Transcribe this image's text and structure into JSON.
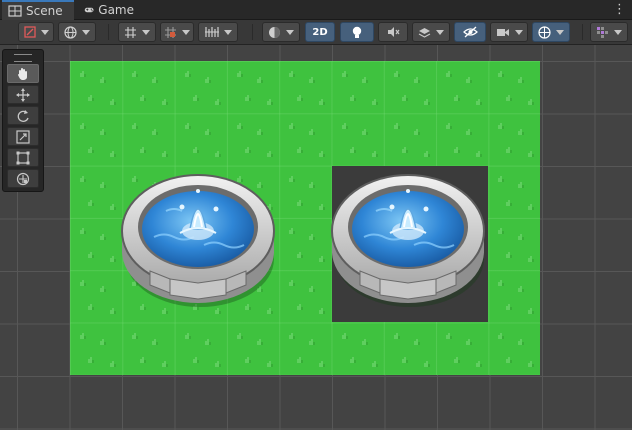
{
  "tabs": [
    {
      "label": "Scene",
      "icon": "scene-grid-icon",
      "active": true
    },
    {
      "label": "Game",
      "icon": "gamepad-icon",
      "active": false
    }
  ],
  "menu_icon": "kebab-menu-icon",
  "toolbar": {
    "mode_2d_label": "2D",
    "mode_2d_active": true,
    "lighting_active": true,
    "gizmo_visibility_active": true,
    "accent_color": "#46607c"
  },
  "tools": [
    {
      "name": "hand-tool",
      "active": true
    },
    {
      "name": "move-tool",
      "active": false
    },
    {
      "name": "rotate-tool",
      "active": false
    },
    {
      "name": "scale-tool",
      "active": false
    },
    {
      "name": "rect-tool",
      "active": false
    },
    {
      "name": "transform-tool",
      "active": false
    }
  ],
  "scene": {
    "grass_color": "#3fc23f",
    "background_color": "#434343",
    "fountains": 2
  }
}
